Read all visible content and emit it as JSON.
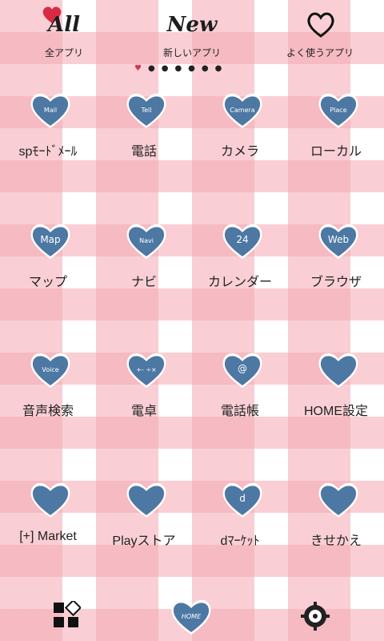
{
  "top_tabs": [
    {
      "word": "All",
      "label": "全アプリ"
    },
    {
      "word": "New",
      "label": "新しいアプリ"
    },
    {
      "word": "",
      "label": "よく使うアプリ"
    }
  ],
  "apps": [
    {
      "label": "spﾓｰﾄﾞﾒｰﾙ",
      "icon_name": "mail-heart-icon",
      "icon_text": "Mail"
    },
    {
      "label": "電話",
      "icon_name": "tell-heart-icon",
      "icon_text": "Tell"
    },
    {
      "label": "カメラ",
      "icon_name": "camera-heart-icon",
      "icon_text": "Camera"
    },
    {
      "label": "ローカル",
      "icon_name": "place-heart-icon",
      "icon_text": "Place"
    },
    {
      "label": "マップ",
      "icon_name": "map-heart-icon",
      "icon_text": "Map"
    },
    {
      "label": "ナビ",
      "icon_name": "navi-heart-icon",
      "icon_text": "Navi"
    },
    {
      "label": "カレンダー",
      "icon_name": "calendar-heart-icon",
      "icon_text": "24"
    },
    {
      "label": "ブラウザ",
      "icon_name": "web-heart-icon",
      "icon_text": "Web"
    },
    {
      "label": "音声検索",
      "icon_name": "voice-heart-icon",
      "icon_text": "Voice"
    },
    {
      "label": "電卓",
      "icon_name": "calculator-heart-icon",
      "icon_text": "+-\n÷×"
    },
    {
      "label": "電話帳",
      "icon_name": "contacts-heart-icon",
      "icon_text": "@"
    },
    {
      "label": "HOME設定",
      "icon_name": "home-settings-heart-icon",
      "icon_text": ""
    },
    {
      "label": "[+] Market",
      "icon_name": "market-heart-icon",
      "icon_text": ""
    },
    {
      "label": "Playストア",
      "icon_name": "play-store-heart-icon",
      "icon_text": ""
    },
    {
      "label": "dﾏｰｹｯﾄ",
      "icon_name": "d-market-heart-icon",
      "icon_text": "d"
    },
    {
      "label": "きせかえ",
      "icon_name": "dress-up-heart-icon",
      "icon_text": ""
    }
  ],
  "dock": [
    {
      "icon_name": "apps-grid-icon"
    },
    {
      "icon_name": "home-heart-icon",
      "icon_text": "HOME"
    },
    {
      "icon_name": "settings-gear-icon"
    }
  ],
  "page_indicator": {
    "count": 7,
    "active": 0
  }
}
